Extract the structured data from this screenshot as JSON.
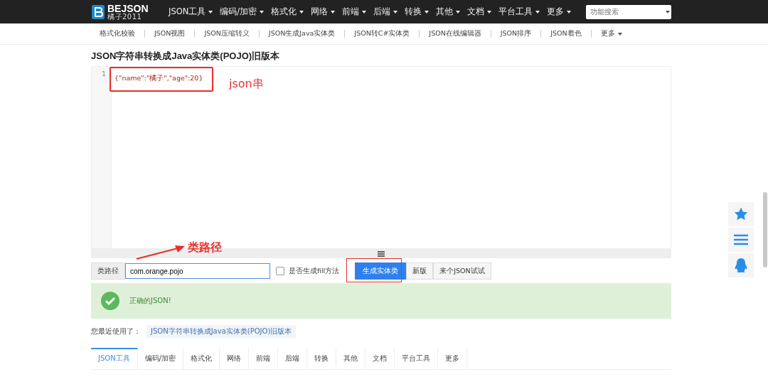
{
  "logo": {
    "name": "BEJSON",
    "subtitle": "橘子2011"
  },
  "top_menu": [
    {
      "label": "JSON工具"
    },
    {
      "label": "编码/加密"
    },
    {
      "label": "格式化"
    },
    {
      "label": "网络"
    },
    {
      "label": "前端"
    },
    {
      "label": "后端"
    },
    {
      "label": "转换"
    },
    {
      "label": "其他"
    },
    {
      "label": "文档"
    },
    {
      "label": "平台工具"
    },
    {
      "label": "更多"
    }
  ],
  "search": {
    "placeholder": "功能搜索"
  },
  "sub_nav": [
    {
      "label": "格式化校验",
      "dropdown": false
    },
    {
      "label": "JSON视图",
      "dropdown": false
    },
    {
      "label": "JSON压缩转义",
      "dropdown": false
    },
    {
      "label": "JSON生成Java实体类",
      "dropdown": false
    },
    {
      "label": "JSON转C#实体类",
      "dropdown": false
    },
    {
      "label": "JSON在线编辑器",
      "dropdown": false
    },
    {
      "label": "JSON排序",
      "dropdown": false
    },
    {
      "label": "JSON着色",
      "dropdown": false
    },
    {
      "label": "更多",
      "dropdown": true
    }
  ],
  "page_title": "JSON字符串转换成Java实体类(POJO)旧版本",
  "editor": {
    "lines": [
      {
        "number": "1",
        "code": "{\"name\":\"橘子\",\"age\":20}"
      }
    ]
  },
  "annotations": {
    "json_label": "json串",
    "path_label": "类路径"
  },
  "form": {
    "path_label": "类路径",
    "path_value": "com.orange.pojo",
    "fill_checkbox": {
      "label": "是否生成fill方法",
      "checked": false
    },
    "buttons": [
      {
        "label": "生成实体类",
        "kind": "primary"
      },
      {
        "label": "新版",
        "kind": "default"
      },
      {
        "label": "来个JSON试试",
        "kind": "default"
      }
    ]
  },
  "alert": {
    "message": "正确的JSON!"
  },
  "recent": {
    "label": "您最近使用了：",
    "item": "JSON字符串转换成Java实体类(POJO)旧版本"
  },
  "bottom_tabs": [
    {
      "label": "JSON工具",
      "selected": true
    },
    {
      "label": "编码/加密",
      "selected": false
    },
    {
      "label": "格式化",
      "selected": false
    },
    {
      "label": "网络",
      "selected": false
    },
    {
      "label": "前端",
      "selected": false
    },
    {
      "label": "后端",
      "selected": false
    },
    {
      "label": "转换",
      "selected": false
    },
    {
      "label": "其他",
      "selected": false
    },
    {
      "label": "文档",
      "selected": false
    },
    {
      "label": "平台工具",
      "selected": false
    },
    {
      "label": "更多",
      "selected": false
    }
  ]
}
